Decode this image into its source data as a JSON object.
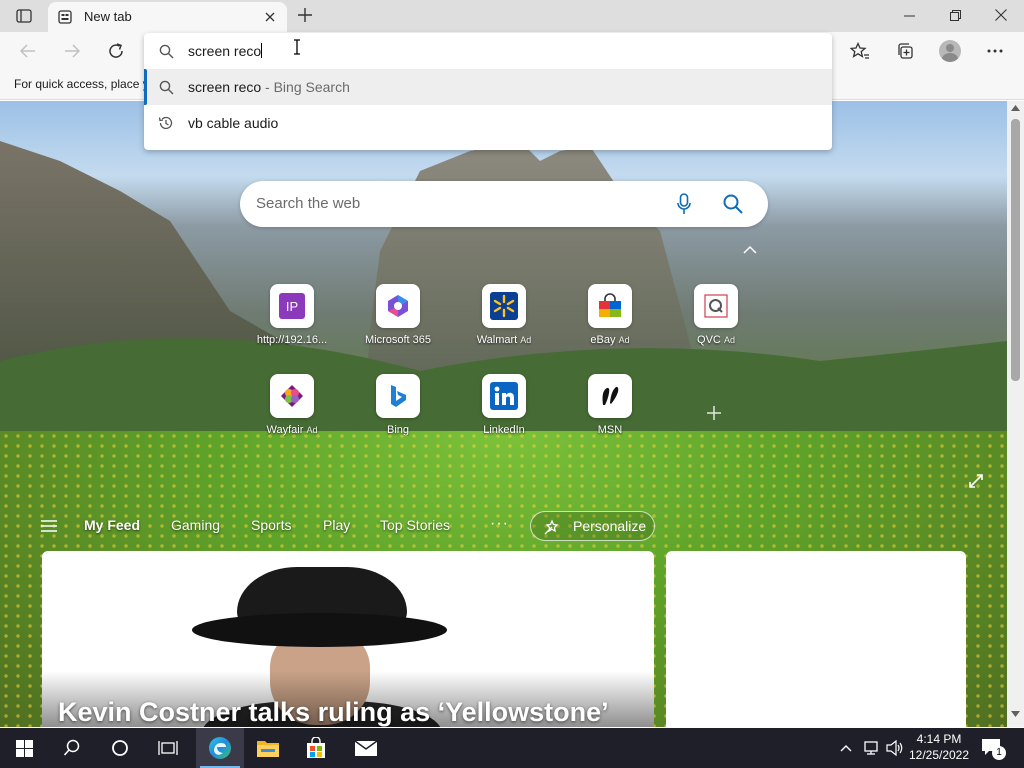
{
  "browser": {
    "tab": {
      "title": "New tab"
    },
    "favorites_bar_message": "For quick access, place y",
    "omnibox": {
      "typed_text": "screen reco",
      "suggestions": [
        {
          "text": "screen reco",
          "suffix": " - Bing Search",
          "icon": "search-icon"
        },
        {
          "text": "vb cable audio",
          "suffix": "",
          "icon": "history-icon"
        }
      ]
    }
  },
  "newtab": {
    "search_placeholder": "Search the web",
    "tiles": [
      {
        "label": "http://192.16...",
        "ad": "",
        "icon": "ip-icon"
      },
      {
        "label": "Microsoft 365",
        "ad": "",
        "icon": "microsoft365-icon"
      },
      {
        "label": "Walmart",
        "ad": "Ad",
        "icon": "walmart-icon"
      },
      {
        "label": "eBay",
        "ad": "Ad",
        "icon": "ebay-icon"
      },
      {
        "label": "QVC",
        "ad": "Ad",
        "icon": "qvc-icon"
      },
      {
        "label": "Wayfair",
        "ad": "Ad",
        "icon": "wayfair-icon"
      },
      {
        "label": "Bing",
        "ad": "",
        "icon": "bing-icon"
      },
      {
        "label": "LinkedIn",
        "ad": "",
        "icon": "linkedin-icon"
      },
      {
        "label": "MSN",
        "ad": "",
        "icon": "msn-icon"
      }
    ],
    "feed_nav": [
      "My Feed",
      "Gaming",
      "Sports",
      "Play",
      "Top Stories"
    ],
    "more_label": "···",
    "personalize_label": "Personalize",
    "headline": "Kevin Costner talks ruling as ‘Yellowstone’"
  },
  "taskbar": {
    "time": "4:14 PM",
    "date": "12/25/2022",
    "notification_count": "1"
  },
  "colors": {
    "accent": "#0f6cbd",
    "taskbar": "#1f1f2a"
  }
}
